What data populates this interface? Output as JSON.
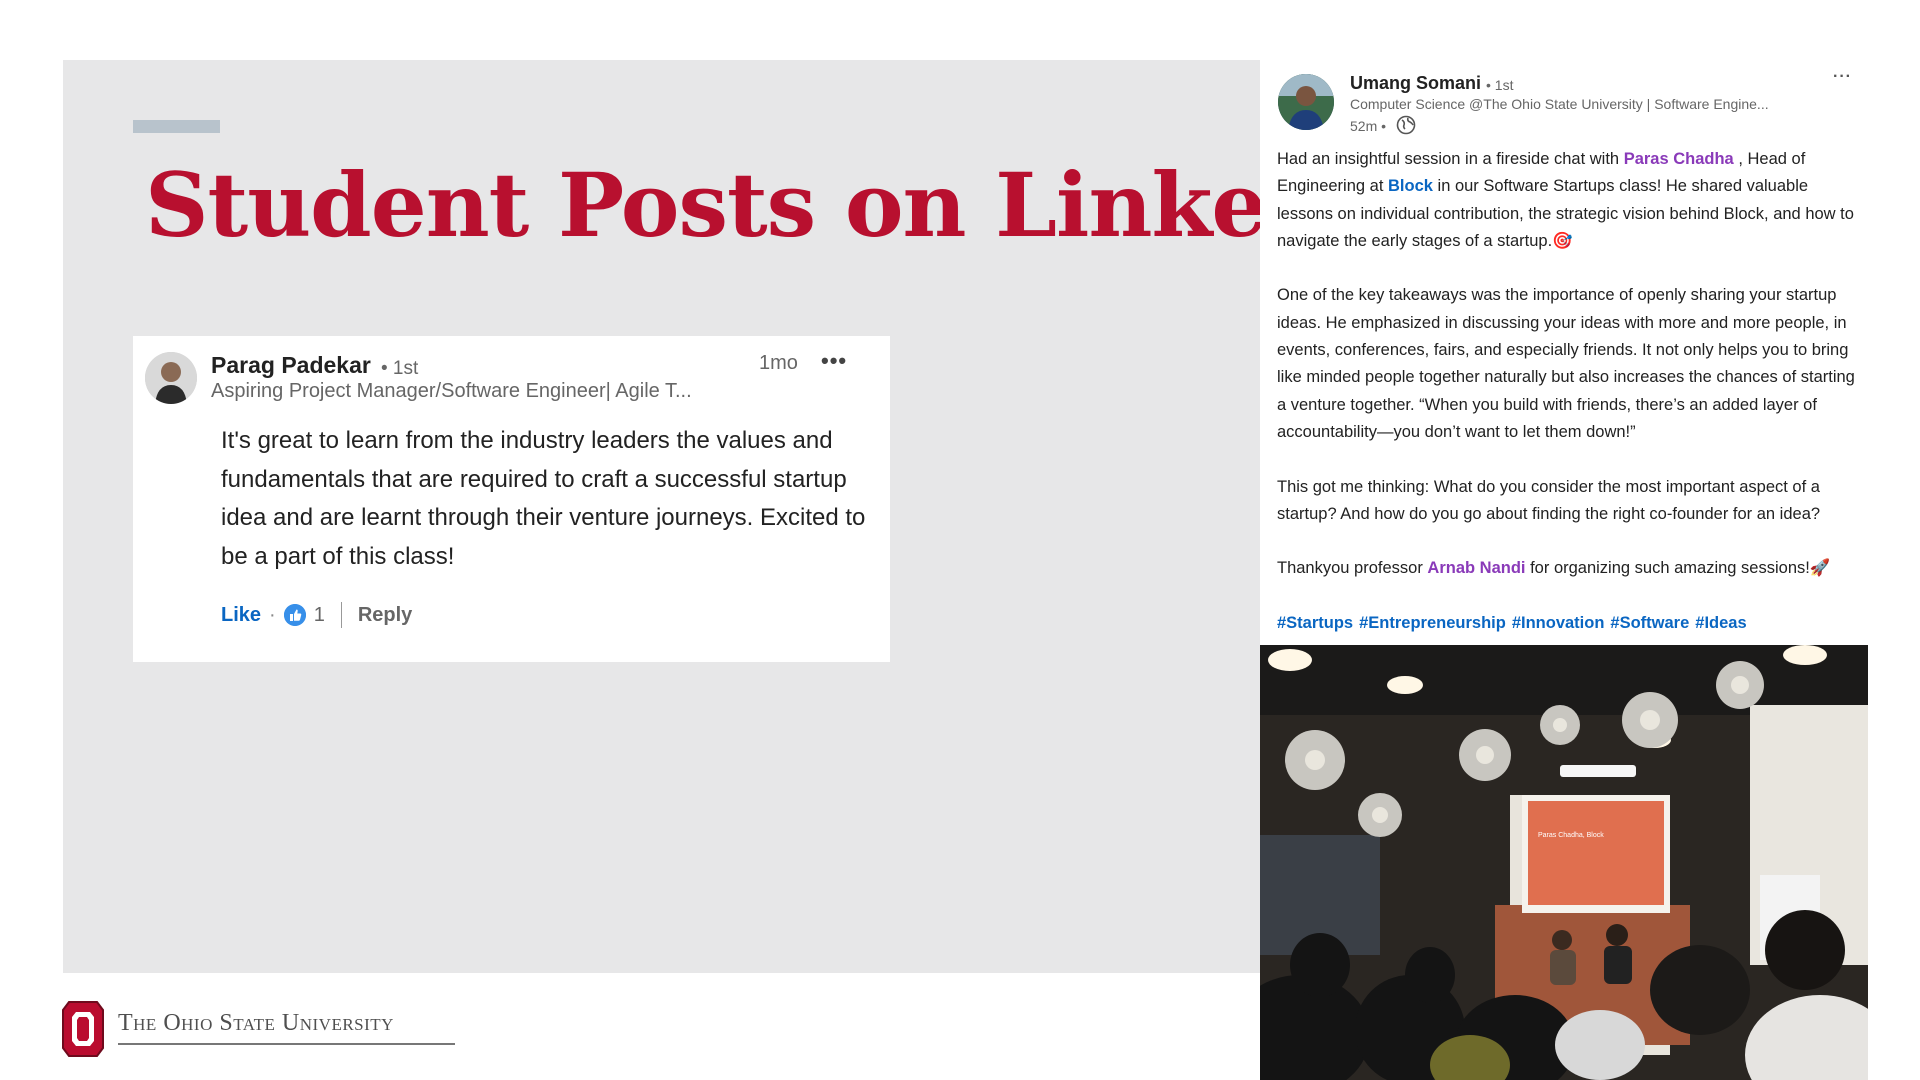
{
  "slide": {
    "title": "Student Posts on LinkedIn",
    "footer_wordmark": "The Ohio State University"
  },
  "comment": {
    "author": "Parag Padekar",
    "degree": "• 1st",
    "headline": "Aspiring Project Manager/Software Engineer| Agile T...",
    "time": "1mo",
    "more_label": "•••",
    "text": "It's great to learn from the industry leaders the values and fundamentals that are required to craft a successful startup idea and are learnt through their venture journeys. Excited to be a part of this class!",
    "like_label": "Like",
    "dot": "·",
    "like_count": "1",
    "reply_label": "Reply"
  },
  "post": {
    "author": "Umang Somani",
    "degree": "• 1st",
    "headline": "Computer Science @The Ohio State University | Software Engine...",
    "time": "52m •",
    "more_label": "···",
    "p1_a": "Had an insightful session in a fireside chat with ",
    "p1_mention": "Paras Chadha",
    "p1_b": " , Head of Engineering at ",
    "p1_company": "Block",
    "p1_c": " in our Software Startups class! He shared valuable lessons on individual contribution, the strategic vision behind Block, and how to navigate the early stages of a startup.🎯",
    "p2": "One of the key takeaways was the importance of openly sharing your startup ideas. He emphasized in discussing your ideas with more and more people, in events, conferences, fairs, and especially friends. It not only helps you to bring like minded people together naturally but also increases the chances of starting a venture together. “When you build with friends, there’s an added layer of accountability—you don’t want to let them down!”",
    "p3": "This got me thinking: What do you consider the most important aspect of a startup? And how do you go about finding the right co-founder for an idea?",
    "p4_a": "Thankyou professor ",
    "p4_mention": "Arnab Nandi",
    "p4_b": " for organizing such amazing sessions!🚀",
    "hashtags": [
      "#Startups",
      "#Entrepreneurship",
      "#Innovation",
      "#Software",
      "#Ideas"
    ],
    "photo_screen_text": "Paras Chadha, Block"
  },
  "colors": {
    "title_red": "#b8102f",
    "panel_gray": "#e7e7e8",
    "link_blue": "#0a66c2",
    "mention_purple": "#8a3ab9"
  },
  "icons": {
    "comment_like": "thumbs-up-icon",
    "post_visibility": "globe-icon",
    "more": "ellipsis-icon",
    "osu_logo": "block-o-logo"
  }
}
